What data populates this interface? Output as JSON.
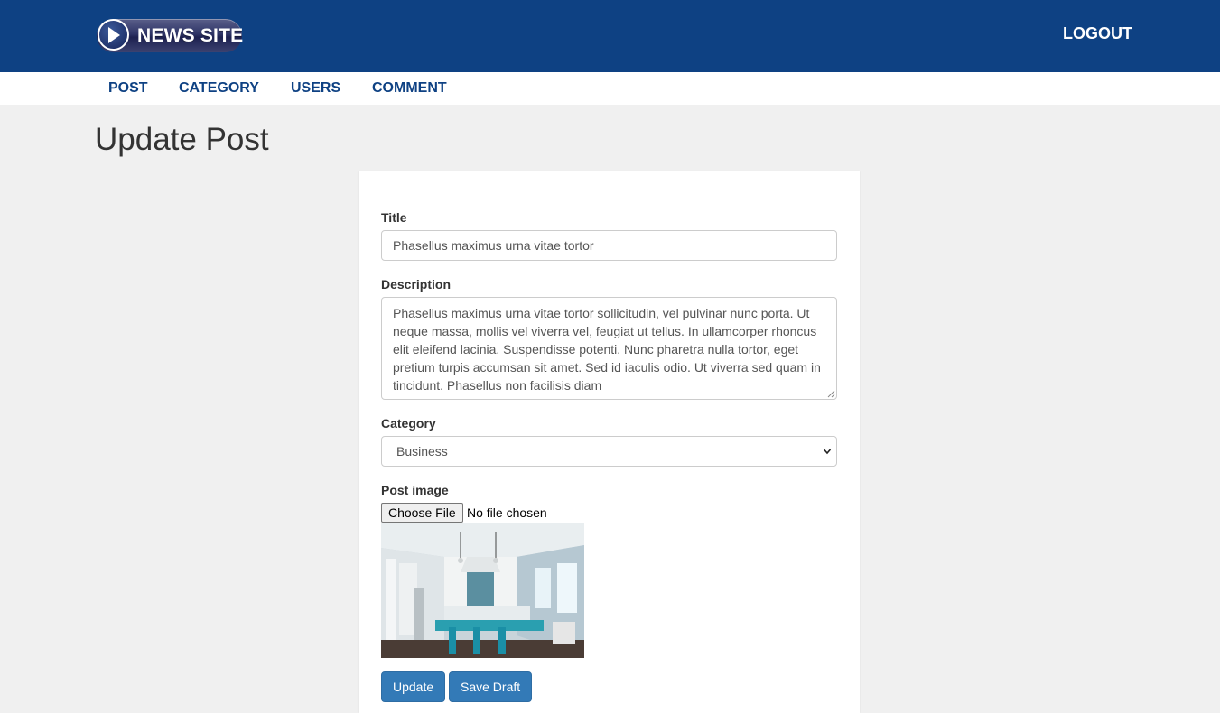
{
  "header": {
    "logo_text": "NEWS SITE",
    "logout_label": "LOGOUT"
  },
  "nav": {
    "items": [
      {
        "label": "POST"
      },
      {
        "label": "CATEGORY"
      },
      {
        "label": "USERS"
      },
      {
        "label": "COMMENT"
      }
    ]
  },
  "page": {
    "title": "Update Post"
  },
  "form": {
    "title_label": "Title",
    "title_value": "Phasellus maximus urna vitae tortor",
    "description_label": "Description",
    "description_value": "Phasellus maximus urna vitae tortor sollicitudin, vel pulvinar nunc porta. Ut neque massa, mollis vel viverra vel, feugiat ut tellus. In ullamcorper rhoncus elit eleifend lacinia. Suspendisse potenti. Nunc pharetra nulla tortor, eget pretium turpis accumsan sit amet. Sed id iaculis odio. Ut viverra sed quam in tincidunt. Phasellus non facilisis diam",
    "category_label": "Category",
    "category_selected": "Business",
    "image_label": "Post image",
    "choose_file_label": "Choose File",
    "file_status": "No file chosen",
    "update_label": "Update",
    "save_draft_label": "Save Draft"
  },
  "colors": {
    "header_bg": "#0e4183",
    "nav_text": "#0e4183",
    "button_bg": "#337ab7",
    "page_bg": "#f0f0f0"
  },
  "icons": [
    "play-icon",
    "chevron-down-icon",
    "resize-grip-icon"
  ]
}
